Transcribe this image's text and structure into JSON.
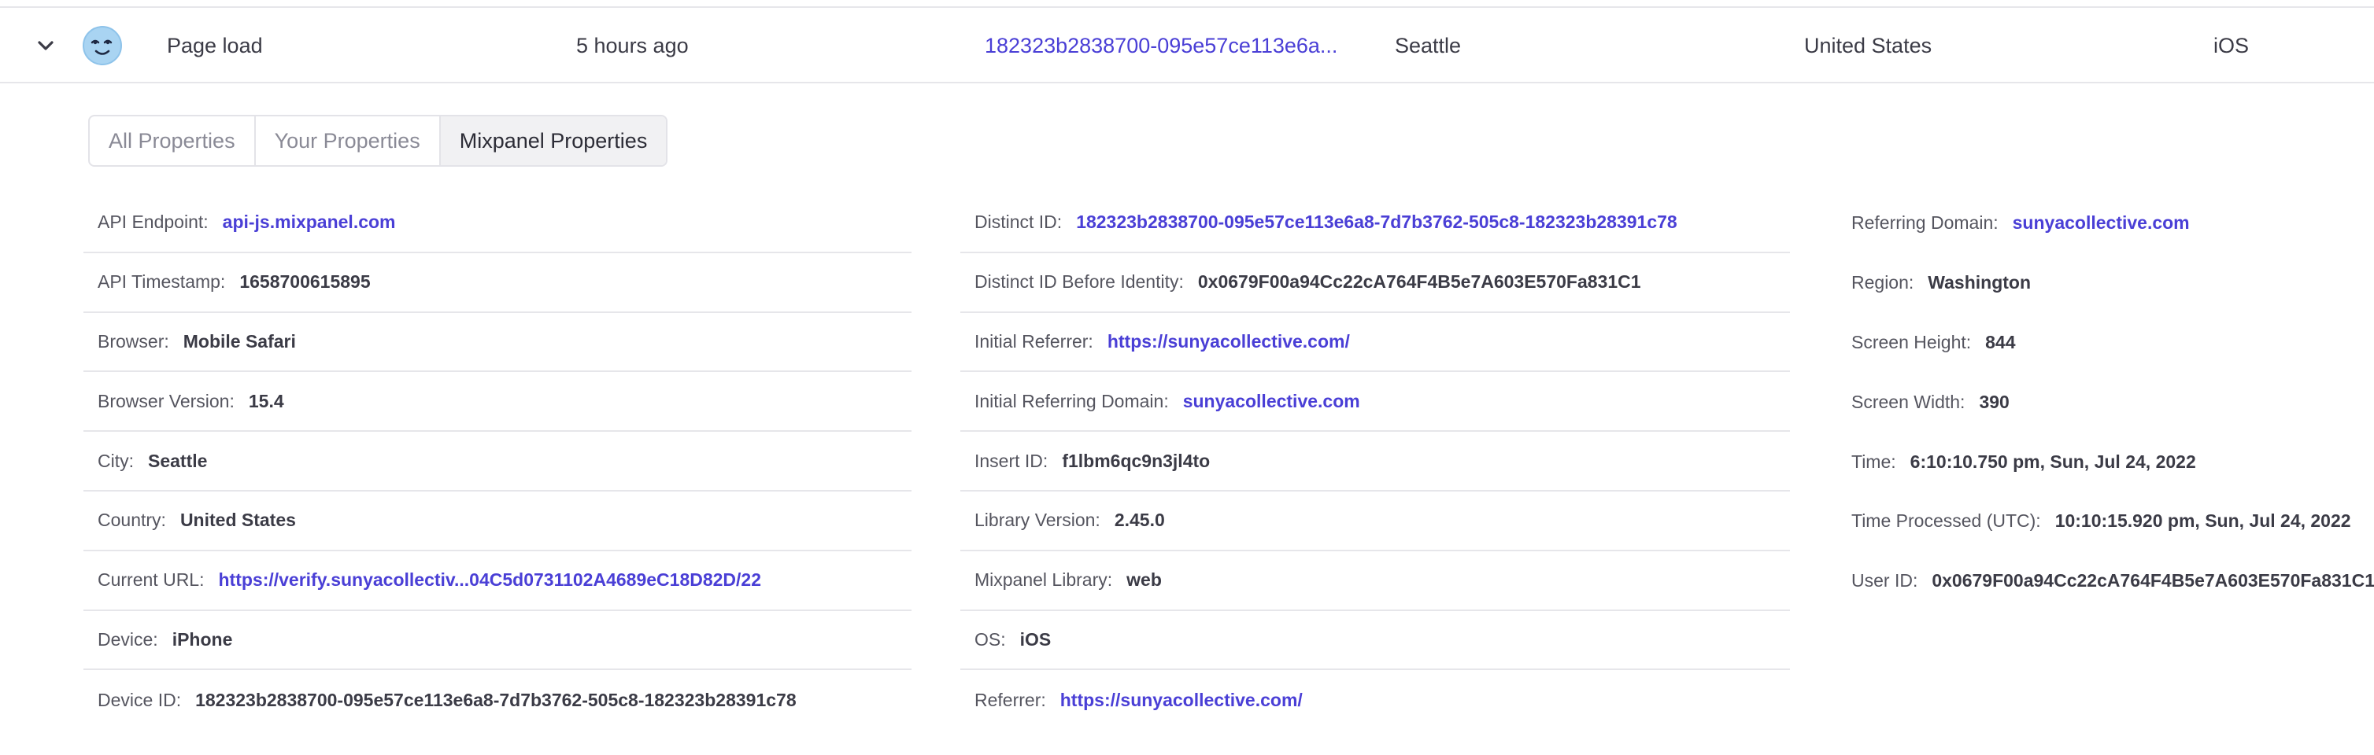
{
  "event_row": {
    "event_name": "Page load",
    "time_ago": "5 hours ago",
    "distinct_id": "182323b2838700-095e57ce113e6a...",
    "city": "Seattle",
    "country": "United States",
    "os": "iOS"
  },
  "tabs": [
    {
      "label": "All Properties",
      "active": false
    },
    {
      "label": "Your Properties",
      "active": false
    },
    {
      "label": "Mixpanel Properties",
      "active": true
    }
  ],
  "colors": {
    "link": "#4a3fd6",
    "text": "#3b3b46",
    "border": "#e6e6ea"
  },
  "properties": {
    "col1": [
      {
        "key": "API Endpoint:",
        "value": "api-js.mixpanel.com",
        "link": true
      },
      {
        "key": "API Timestamp:",
        "value": "1658700615895",
        "link": false
      },
      {
        "key": "Browser:",
        "value": "Mobile Safari",
        "link": false
      },
      {
        "key": "Browser Version:",
        "value": "15.4",
        "link": false
      },
      {
        "key": "City:",
        "value": "Seattle",
        "link": false
      },
      {
        "key": "Country:",
        "value": "United States",
        "link": false
      },
      {
        "key": "Current URL:",
        "value": "https://verify.sunyacollectiv...04C5d0731102A4689eC18D82D/22",
        "link": true
      },
      {
        "key": "Device:",
        "value": "iPhone",
        "link": false
      },
      {
        "key": "Device ID:",
        "value": "182323b2838700-095e57ce113e6a8-7d7b3762-505c8-182323b28391c78",
        "link": false
      }
    ],
    "col2": [
      {
        "key": "Distinct ID:",
        "value": "182323b2838700-095e57ce113e6a8-7d7b3762-505c8-182323b28391c78",
        "link": true
      },
      {
        "key": "Distinct ID Before Identity:",
        "value": "0x0679F00a94Cc22cA764F4B5e7A603E570Fa831C1",
        "link": false
      },
      {
        "key": "Initial Referrer:",
        "value": "https://sunyacollective.com/",
        "link": true
      },
      {
        "key": "Initial Referring Domain:",
        "value": "sunyacollective.com",
        "link": true
      },
      {
        "key": "Insert ID:",
        "value": "f1lbm6qc9n3jl4to",
        "link": false
      },
      {
        "key": "Library Version:",
        "value": "2.45.0",
        "link": false
      },
      {
        "key": "Mixpanel Library:",
        "value": "web",
        "link": false
      },
      {
        "key": "OS:",
        "value": "iOS",
        "link": false
      },
      {
        "key": "Referrer:",
        "value": "https://sunyacollective.com/",
        "link": true
      }
    ],
    "col3": [
      {
        "key": "Referring Domain:",
        "value": "sunyacollective.com",
        "link": true
      },
      {
        "key": "Region:",
        "value": "Washington",
        "link": false
      },
      {
        "key": "Screen Height:",
        "value": "844",
        "link": false
      },
      {
        "key": "Screen Width:",
        "value": "390",
        "link": false
      },
      {
        "key": "Time:",
        "value": "6:10:10.750 pm, Sun, Jul 24, 2022",
        "link": false
      },
      {
        "key": "Time Processed (UTC):",
        "value": "10:10:15.920 pm, Sun, Jul 24, 2022",
        "link": false
      },
      {
        "key": "User ID:",
        "value": "0x0679F00a94Cc22cA764F4B5e7A603E570Fa831C1",
        "link": false
      }
    ]
  }
}
